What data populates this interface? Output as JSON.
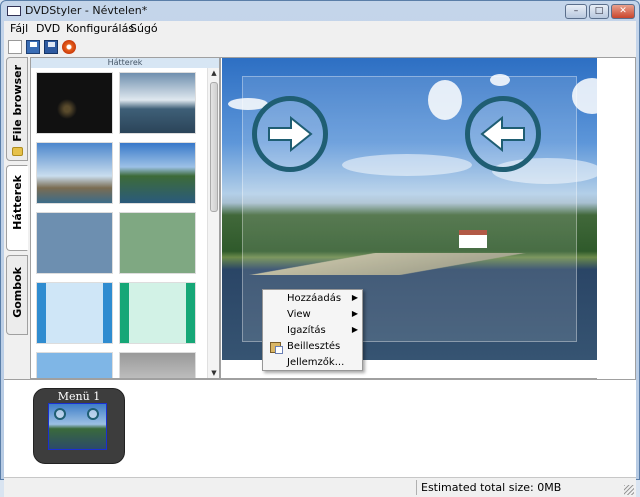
{
  "window": {
    "title": "DVDStyler - Névtelen*",
    "controls": {
      "minimize": "–",
      "maximize": "□",
      "close": "✕"
    }
  },
  "menubar": {
    "items": [
      "Fájl",
      "DVD",
      "Konfigurálás",
      "Súgó"
    ]
  },
  "toolbar": {
    "buttons": [
      "new-icon",
      "open-icon",
      "save-icon",
      "burn-icon"
    ]
  },
  "side_tabs": [
    {
      "label": "File browser",
      "icon": "folder-icon"
    },
    {
      "label": "Hátterek"
    },
    {
      "label": "Gombok"
    }
  ],
  "backgrounds_panel": {
    "header": "Hátterek",
    "thumbnails": [
      "night-scene",
      "sea-cliff",
      "harbor",
      "river-bank",
      "blue-blur",
      "green-blur",
      "blue-stripes",
      "green-stripes"
    ]
  },
  "context_menu": {
    "items": [
      {
        "label": "Hozzáadás",
        "submenu": true
      },
      {
        "label": "View",
        "submenu": true
      },
      {
        "label": "Igazítás",
        "submenu": true
      },
      {
        "label": "Beillesztés",
        "icon": "paste-icon"
      },
      {
        "label": "Jellemzők..."
      }
    ],
    "submenu_arrow": "▶"
  },
  "menus_panel": {
    "items": [
      {
        "title": "Menü 1"
      }
    ]
  },
  "statusbar": {
    "total_size": "Estimated total size: 0MB"
  },
  "colors": {
    "button_ring": "#1f5e73",
    "selection_border": "#1a2fd0"
  }
}
